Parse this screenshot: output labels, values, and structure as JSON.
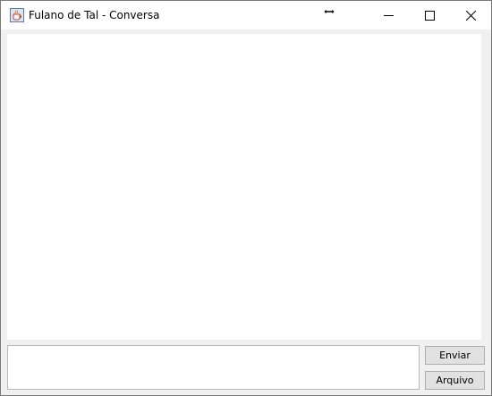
{
  "window": {
    "title": "Fulano de Tal - Conversa",
    "controls": {
      "minimize_icon": "minimize-icon",
      "maximize_icon": "maximize-icon",
      "close_icon": "close-icon"
    },
    "app_icon": "java-coffee-cup-icon"
  },
  "chat": {
    "history": "",
    "input_value": "",
    "send_label": "Enviar",
    "file_label": "Arquivo"
  },
  "colors": {
    "window_bg": "#f0f0f0",
    "titlebar_bg": "#ffffff",
    "button_bg": "#e1e1e1",
    "button_border": "#adadad"
  }
}
